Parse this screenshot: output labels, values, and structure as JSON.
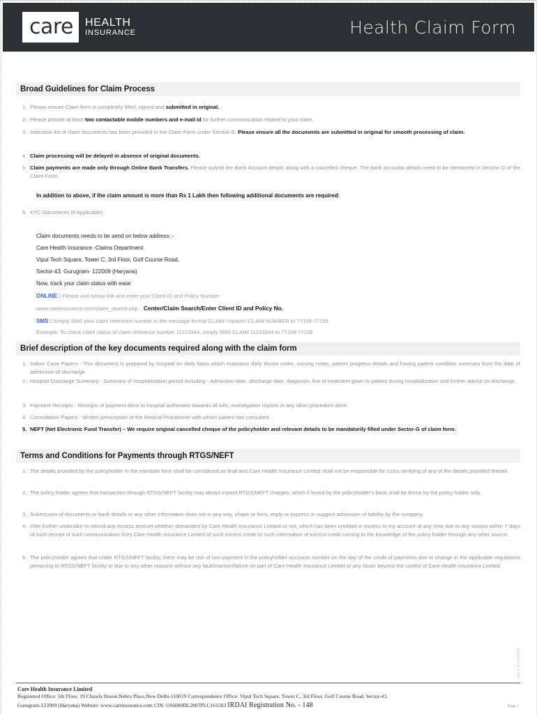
{
  "header": {
    "logo_word": "care",
    "logo_line1": "HEALTH",
    "logo_line2": "INSURANCE",
    "title": "Health Claim Form",
    "band_color": "#2b3033"
  },
  "accent_blue": "#3a5fe0",
  "section_bar_color": "#f0f0f0",
  "sections": [
    {
      "id": "broad-guidelines",
      "heading": "Broad Guidelines for Claim Process"
    },
    {
      "id": "brief-description",
      "heading": "Brief description of the key documents required along with the claim form"
    },
    {
      "id": "terms-conditions",
      "heading": "Terms and Conditions for Payments through RTGS/NEFT"
    }
  ],
  "guidelines": {
    "items": [
      {
        "num": "1.",
        "plain_1": "Please ensure Claim form is completely filled, signed and ",
        "bold_1": "submitted in original.",
        "plain_2": ""
      },
      {
        "num": "2.",
        "plain_1": "Please provide at least ",
        "bold_1": "two contactable mobile numbers and e-mail id",
        "plain_2": " for further communication related to your claim."
      },
      {
        "num": "3.",
        "plain_1": "Indicative list of claim documents has been provided in the Claim Form under Section E. ",
        "bold_1": "Please ensure all the documents are submitted in original for smooth processing of claim.",
        "plain_2": ""
      },
      {
        "num": "4.",
        "plain_1": "",
        "bold_1": "Claim processing will be delayed in absence of original documents.",
        "plain_2": ""
      },
      {
        "num": "5.",
        "plain_1": "",
        "bold_1": "Claim payments are made only through Online Bank Transfers.",
        "plain_2": " Please submit the Bank Account details along with a cancelled cheque. The bank accounts details need to be mentioned in Section G of the Claim Form."
      },
      {
        "num": "6.",
        "plain_1": "KYC Documents (If Applicable)",
        "bold_1": "",
        "plain_2": ""
      }
    ],
    "note_more_than_lakh": "In addition to above, if the claim amount is more than Rs 1 Lakh then following additional documents are required:"
  },
  "address_block": {
    "lead": "Claim documents needs to be send on below address: -",
    "line1": "Care Health Insurance -Claims Department",
    "line2": "Vipul Tech Square, Tower C, 3rd Floor, Golf Course Road,",
    "line3": "Sector-43, Gurugram- 122009 (Haryana)",
    "track_lead": "Now, track your claim status with ease"
  },
  "channels": {
    "online_tag": "ONLINE :",
    "online_text": "Please visit below link and enter your Client ID and Policy Number",
    "online_url": "www.careinsurance.com/claim_search.php",
    "online_path_bold": "Center/Claim Search/Enter Client ID and Policy No.",
    "sms_tag": "SMS :",
    "sms_text": "Simply SMS your claim reference number in the message format CLAIM <space> CLAIM NUMBER  to 77158-77158",
    "sms_example": "Example: To check claim status of claim reference number 11223344, simply SMS CLAIM 11223344 to 77158-77158"
  },
  "key_documents": {
    "items": [
      {
        "num": "1.",
        "text": "Indoor Case Papers - This document is prepared by hospital on daily basis which maintains daily doctor notes, nursing notes, patient progress details and having patient condition summary from the date of admission till discharge.",
        "bold": false
      },
      {
        "num": "2.",
        "text": "Hospital Discharge Summary - Summary of hospitalization period including - Admission date, discharge date, diagnosis, line of treatment given to patient during hospitalization and further advice on discharge.",
        "bold": false
      },
      {
        "num": "3.",
        "text": "Payment Receipts - Receipts of payment done to hospital authorities towards all bills, investigation reports or any other procedure done.",
        "bold": false
      },
      {
        "num": "4.",
        "text": "Consultation Papers - Written prescription of the Medical Practitioner with whom patient has consulted.",
        "bold": false
      },
      {
        "num": "5.",
        "text": "NEFT (Net Electronic Fund Transfer) – We require original cancelled cheque of the policyholder and relevant details to be mandatorily filled under Sector-G of claim form.",
        "bold": true
      }
    ]
  },
  "terms": {
    "items": [
      {
        "num": "1.",
        "text": "The details provided by the policyholder in the mandate form shall be considered as final and Care Health Insurance Limited shall not be responsible for cross verifying of any of the details provided therein."
      },
      {
        "num": "2.",
        "text": "The policy holder agrees that transaction through RTGS/NEFT facility may attract inward RTGS/NEFT charges, which if levied by the policyholder's bank shall be borne by the policy holder only."
      },
      {
        "num": "3.",
        "text": "Submission of documents or bank details or any other information does not in any way, shape or form, imply or express or suggest admission of liability by the company."
      },
      {
        "num": "4.",
        "text": "I/We further undertake to refund any excess amount whether demanded by Care Health Insurance Limited or  not, which has been credited in excess to my account at  any  time due to any reason within 7 days of such receipt of such communication from Care Health Insurance Limited of  such excess credit or such information of excess credit coming to the knowledge of the policy holder through any other source."
      },
      {
        "num": "5.",
        "text": "The policyholder agrees that under RTGS/NEFT facility, there may be risk of non-payment in the policyholder accounts number on the day of the credit of payments due to change in the applicable regulations pertaining to RTGS/NEFT facility or due to any other reasons without any fault/inaction/failure on part of Care Health Insurance Limited or any factor beyond the control of Care Health Insurance Limited."
      }
    ]
  },
  "footer": {
    "company": "Care Health Insurance Limited",
    "line2": "Registered Office: 5th Floor, 19 Chawla House,Nehru Place,New Delhi-110019    Correspondence Office: Vipul Tech Square, Tower C, 3rd Floor, Golf Course Road, Sector-43,",
    "line3_pre": "Gurugram-122009 (Haryana)   Website: www.careinsurance.com   CIN: U66000DL2007PLC161503",
    "irdai": "IRDAI Registration No. - 148",
    "page_label": "Page 1",
    "vertical_code": "Ver 1.0/V1/2016"
  }
}
